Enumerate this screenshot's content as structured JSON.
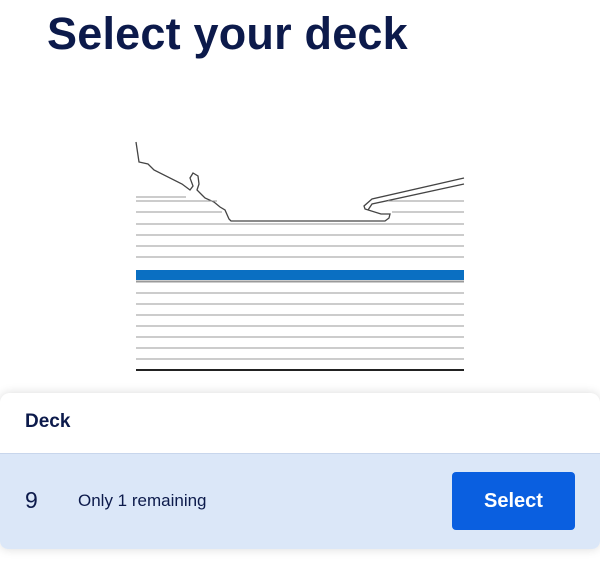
{
  "header": {
    "title": "Select your deck"
  },
  "diagram": {
    "icon": "ship-cross-section-diagram",
    "highlight_color": "#0a6fc2",
    "line_color": "#444444"
  },
  "deck_card": {
    "header_label": "Deck",
    "rows": [
      {
        "deck_number": "9",
        "availability": "Only 1 remaining",
        "select_label": "Select"
      }
    ]
  },
  "colors": {
    "primary_text": "#0c1a4b",
    "button_bg": "#0a5fe0",
    "row_bg": "#dbe7f8"
  }
}
